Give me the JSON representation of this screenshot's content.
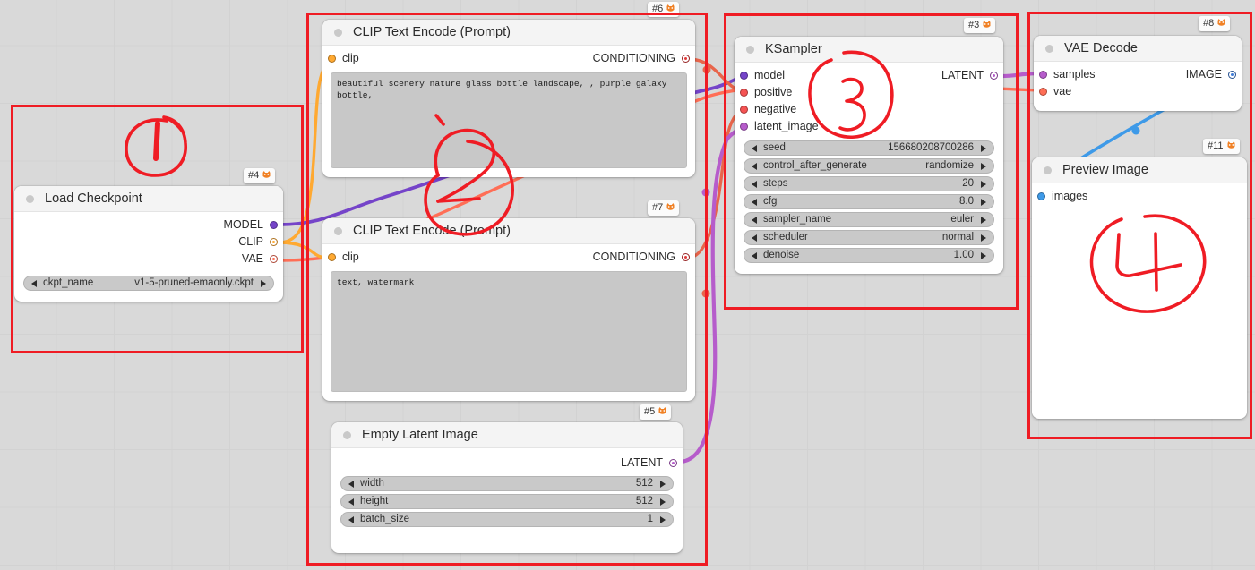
{
  "canvas": {
    "background": "#d9d9d9",
    "grid_color": "#d2d2d2"
  },
  "annotations": {
    "color": "#ef1c24",
    "marks": [
      {
        "label": "1",
        "target": "Load Checkpoint"
      },
      {
        "label": "2",
        "target": "CLIP Text Encode (Prompt) - positive"
      },
      {
        "label": "3",
        "target": "KSampler"
      },
      {
        "label": "4",
        "target": "Preview Image"
      }
    ]
  },
  "nodes": {
    "load_checkpoint": {
      "badge": "#4",
      "title": "Load Checkpoint",
      "outputs": [
        {
          "label": "MODEL",
          "color": "#7544c9"
        },
        {
          "label": "CLIP",
          "color": "#ffa931"
        },
        {
          "label": "VAE",
          "color": "#ff6e56"
        }
      ],
      "widgets": [
        {
          "name": "ckpt_name",
          "value": "v1-5-pruned-emaonly.ckpt"
        }
      ]
    },
    "clip_positive": {
      "badge": "#6",
      "title": "CLIP Text Encode (Prompt)",
      "inputs": [
        {
          "label": "clip",
          "color": "#ffa931"
        }
      ],
      "outputs": [
        {
          "label": "CONDITIONING",
          "color": "#e03a3a"
        }
      ],
      "text": "beautiful scenery nature glass bottle landscape, , purple galaxy bottle,"
    },
    "clip_negative": {
      "badge": "#7",
      "title": "CLIP Text Encode (Prompt)",
      "inputs": [
        {
          "label": "clip",
          "color": "#ffa931"
        }
      ],
      "outputs": [
        {
          "label": "CONDITIONING",
          "color": "#e03a3a"
        }
      ],
      "text": "text, watermark"
    },
    "empty_latent": {
      "badge": "#5",
      "title": "Empty Latent Image",
      "outputs": [
        {
          "label": "LATENT",
          "color": "#b65ccb"
        }
      ],
      "widgets": [
        {
          "name": "width",
          "value": "512"
        },
        {
          "name": "height",
          "value": "512"
        },
        {
          "name": "batch_size",
          "value": "1"
        }
      ]
    },
    "ksampler": {
      "badge": "#3",
      "title": "KSampler",
      "inputs": [
        {
          "label": "model",
          "color": "#7544c9"
        },
        {
          "label": "positive",
          "color": "#f55353"
        },
        {
          "label": "negative",
          "color": "#f55353"
        },
        {
          "label": "latent_image",
          "color": "#b65ccb"
        }
      ],
      "outputs": [
        {
          "label": "LATENT",
          "color": "#b65ccb"
        }
      ],
      "widgets": [
        {
          "name": "seed",
          "value": "156680208700286"
        },
        {
          "name": "control_after_generate",
          "value": "randomize"
        },
        {
          "name": "steps",
          "value": "20"
        },
        {
          "name": "cfg",
          "value": "8.0"
        },
        {
          "name": "sampler_name",
          "value": "euler"
        },
        {
          "name": "scheduler",
          "value": "normal"
        },
        {
          "name": "denoise",
          "value": "1.00"
        }
      ]
    },
    "vae_decode": {
      "badge": "#8",
      "title": "VAE Decode",
      "inputs": [
        {
          "label": "samples",
          "color": "#b65ccb"
        },
        {
          "label": "vae",
          "color": "#ff6e56"
        }
      ],
      "outputs": [
        {
          "label": "IMAGE",
          "color": "#3e7cd8"
        }
      ]
    },
    "preview_image": {
      "badge": "#11",
      "title": "Preview Image",
      "inputs": [
        {
          "label": "images",
          "color": "#3e9ae8"
        }
      ]
    }
  },
  "links": [
    {
      "from": "load_checkpoint.MODEL",
      "to": "ksampler.model",
      "color": "#7544c9"
    },
    {
      "from": "load_checkpoint.CLIP",
      "to": "clip_positive.clip",
      "color": "#ffa931"
    },
    {
      "from": "load_checkpoint.CLIP",
      "to": "clip_negative.clip",
      "color": "#ffa931"
    },
    {
      "from": "load_checkpoint.VAE",
      "to": "vae_decode.vae",
      "color": "#ff6e56"
    },
    {
      "from": "clip_positive.CONDITIONING",
      "to": "ksampler.positive",
      "color": "#e8654b"
    },
    {
      "from": "clip_negative.CONDITIONING",
      "to": "ksampler.negative",
      "color": "#e8654b"
    },
    {
      "from": "empty_latent.LATENT",
      "to": "ksampler.latent_image",
      "color": "#b65ccb"
    },
    {
      "from": "ksampler.LATENT",
      "to": "vae_decode.samples",
      "color": "#b65ccb"
    },
    {
      "from": "vae_decode.IMAGE",
      "to": "preview_image.images",
      "color": "#3e9ae8"
    }
  ]
}
